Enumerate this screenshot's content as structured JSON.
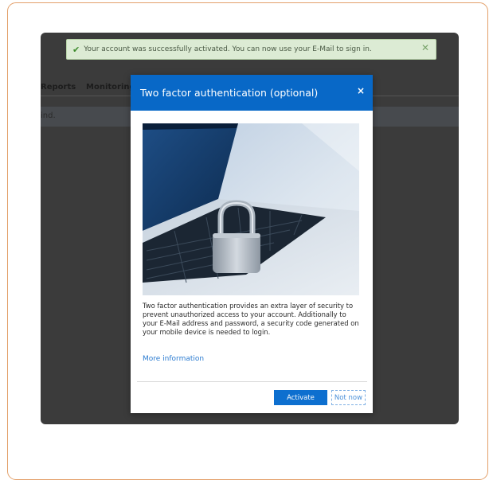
{
  "nav": {
    "reports": "Reports",
    "monitoring": "Monitoring"
  },
  "banner_text": "ind.",
  "alert": {
    "message": "Your account was successfully activated. You can now use your E-Mail to sign in.",
    "close_symbol": "✕"
  },
  "modal": {
    "title": "Two factor authentication (optional)",
    "close_symbol": "×",
    "body": "Two factor authentication provides an extra layer of security to prevent unauthorized access to your account. Additionally to your E-Mail address and password, a security code generated on your mobile device is needed to login.",
    "more_info": "More information",
    "activate": "Activate",
    "not_now": "Not now"
  },
  "colors": {
    "primary": "#0868c7",
    "success_bg": "#dcebd4",
    "link": "#2b7bd0",
    "frame_border": "#e3a06a"
  },
  "icons": [
    "check-icon",
    "close-icon",
    "padlock-laptop-image"
  ]
}
